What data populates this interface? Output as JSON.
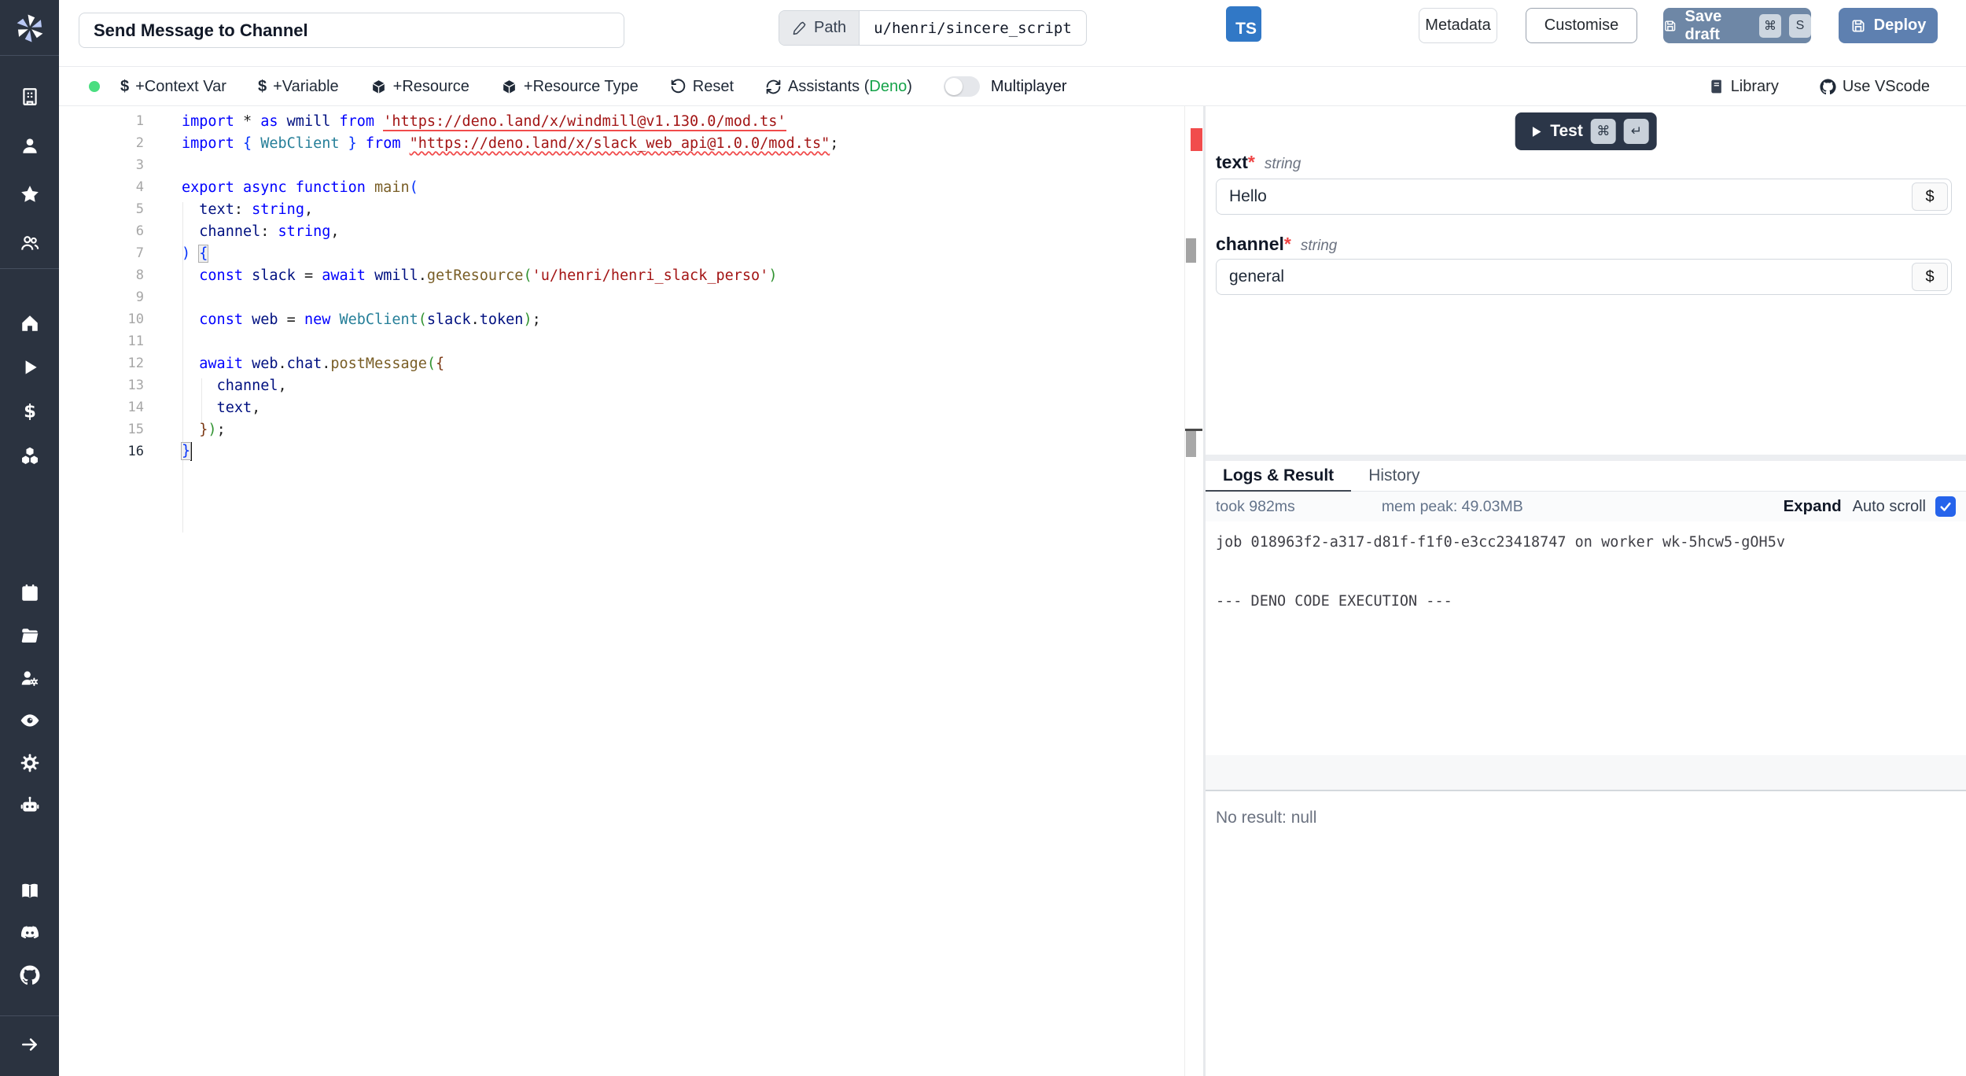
{
  "colors": {
    "sidebar_bg": "#2b3340",
    "ts_badge": "#3178c6",
    "save_draft_button": "#6e87a6",
    "deploy_button": "#5e80b0",
    "status_dot": "#4ade80",
    "deno_green": "#16a34a",
    "checkbox_blue": "#2563eb",
    "test_button": "#2b3648",
    "error_marker": "#f14c4c"
  },
  "header": {
    "title_value": "Send Message to Channel",
    "path_label": "Path",
    "path_value": "u/henri/sincere_script",
    "lang_badge": "TS",
    "metadata_label": "Metadata",
    "customise_label": "Customise",
    "save_draft_label": "Save draft",
    "save_kbd_1": "⌘",
    "save_kbd_2": "S",
    "deploy_label": "Deploy"
  },
  "toolbar": {
    "context_var": "+Context Var",
    "variable": "+Variable",
    "resource": "+Resource",
    "resource_type": "+Resource Type",
    "reset": "Reset",
    "assistants_prefix": "Assistants (",
    "assistants_engine": "Deno",
    "assistants_suffix": ")",
    "multiplayer": "Multiplayer",
    "library": "Library",
    "vscode": "Use VScode"
  },
  "sidebar": {
    "icons_a": [
      "building",
      "user",
      "star",
      "users"
    ],
    "icons_b": [
      "home",
      "play",
      "dollar",
      "boxes"
    ],
    "icons_c": [
      "calendar",
      "folder",
      "usercog",
      "eye",
      "gear",
      "bot"
    ],
    "icons_d": [
      "book",
      "discord",
      "github"
    ],
    "expand_icon": "arrow-right"
  },
  "editor": {
    "lines": [
      {
        "n": 1,
        "t": [
          [
            "t-k",
            "import "
          ],
          [
            "t-p",
            "* "
          ],
          [
            "t-k",
            "as "
          ],
          [
            "t-v",
            "wmill "
          ],
          [
            "t-k",
            "from "
          ],
          [
            "t-s u1",
            "'https://deno.land/x/windmill@v1.130.0/mod.ts'"
          ]
        ]
      },
      {
        "n": 2,
        "t": [
          [
            "t-k",
            "import "
          ],
          [
            "t-b1",
            "{ "
          ],
          [
            "t-c",
            "WebClient"
          ],
          [
            "t-b1",
            " }"
          ],
          [
            "t-k",
            " from "
          ],
          [
            "t-s u2",
            "\"https://deno.land/x/slack_web_api@1.0.0/mod.ts\""
          ],
          [
            "t-p",
            ";"
          ]
        ]
      },
      {
        "n": 3,
        "t": []
      },
      {
        "n": 4,
        "t": [
          [
            "t-k",
            "export async function "
          ],
          [
            "t-f",
            "main"
          ],
          [
            "t-b1",
            "("
          ]
        ]
      },
      {
        "n": 5,
        "t": [
          [
            "t-p",
            "  "
          ],
          [
            "t-v",
            "text"
          ],
          [
            "t-p",
            ": "
          ],
          [
            "t-k",
            "string"
          ],
          [
            "t-p",
            ","
          ]
        ]
      },
      {
        "n": 6,
        "t": [
          [
            "t-p",
            "  "
          ],
          [
            "t-v",
            "channel"
          ],
          [
            "t-p",
            ": "
          ],
          [
            "t-k",
            "string"
          ],
          [
            "t-p",
            ","
          ]
        ]
      },
      {
        "n": 7,
        "t": [
          [
            "t-b1",
            ")"
          ],
          [
            "t-p",
            " "
          ],
          [
            "t-b1 bm",
            "{"
          ]
        ]
      },
      {
        "n": 8,
        "t": [
          [
            "t-p",
            "  "
          ],
          [
            "t-k",
            "const "
          ],
          [
            "t-v",
            "slack"
          ],
          [
            "t-p",
            " = "
          ],
          [
            "t-k",
            "await "
          ],
          [
            "t-v",
            "wmill"
          ],
          [
            "t-p",
            "."
          ],
          [
            "t-f",
            "getResource"
          ],
          [
            "t-b2",
            "("
          ],
          [
            "t-s",
            "'u/henri/henri_slack_perso'"
          ],
          [
            "t-b2",
            ")"
          ]
        ]
      },
      {
        "n": 9,
        "t": []
      },
      {
        "n": 10,
        "t": [
          [
            "t-p",
            "  "
          ],
          [
            "t-k",
            "const "
          ],
          [
            "t-v",
            "web"
          ],
          [
            "t-p",
            " = "
          ],
          [
            "t-k",
            "new "
          ],
          [
            "t-c",
            "WebClient"
          ],
          [
            "t-b2",
            "("
          ],
          [
            "t-v",
            "slack"
          ],
          [
            "t-p",
            "."
          ],
          [
            "t-v",
            "token"
          ],
          [
            "t-b2",
            ")"
          ],
          [
            "t-p",
            ";"
          ]
        ]
      },
      {
        "n": 11,
        "t": []
      },
      {
        "n": 12,
        "t": [
          [
            "t-p",
            "  "
          ],
          [
            "t-k",
            "await "
          ],
          [
            "t-v",
            "web"
          ],
          [
            "t-p",
            "."
          ],
          [
            "t-v",
            "chat"
          ],
          [
            "t-p",
            "."
          ],
          [
            "t-f",
            "postMessage"
          ],
          [
            "t-b2",
            "("
          ],
          [
            "t-b3",
            "{"
          ]
        ]
      },
      {
        "n": 13,
        "t": [
          [
            "t-p",
            "    "
          ],
          [
            "t-v",
            "channel"
          ],
          [
            "t-p",
            ","
          ]
        ]
      },
      {
        "n": 14,
        "t": [
          [
            "t-p",
            "    "
          ],
          [
            "t-v",
            "text"
          ],
          [
            "t-p",
            ","
          ]
        ]
      },
      {
        "n": 15,
        "t": [
          [
            "t-p",
            "  "
          ],
          [
            "t-b3",
            "}"
          ],
          [
            "t-b2",
            ")"
          ],
          [
            "t-p",
            ";"
          ]
        ]
      },
      {
        "n": 16,
        "t": [
          [
            "t-b1 bm",
            "}"
          ],
          [
            "caret",
            ""
          ]
        ]
      }
    ],
    "current_line": 16
  },
  "runner": {
    "test_label": "Test",
    "test_kbd_1": "⌘",
    "test_kbd_2": "↵",
    "dollar_button": "$",
    "args": [
      {
        "name": "text",
        "required": "*",
        "type": "string",
        "value": "Hello"
      },
      {
        "name": "channel",
        "required": "*",
        "type": "string",
        "value": "general"
      }
    ]
  },
  "results": {
    "tab_logs": "Logs & Result",
    "tab_history": "History",
    "active_tab": "Logs & Result",
    "took": "took 982ms",
    "mem_peak": "mem peak: 49.03MB",
    "expand": "Expand",
    "autoscroll": "Auto scroll",
    "autoscroll_checked": true,
    "log_lines": [
      "job 018963f2-a317-d81f-f1f0-e3cc23418747 on worker wk-5hcw5-gOH5v",
      "",
      "",
      "--- DENO CODE EXECUTION ---"
    ],
    "no_result": "No result: null"
  }
}
